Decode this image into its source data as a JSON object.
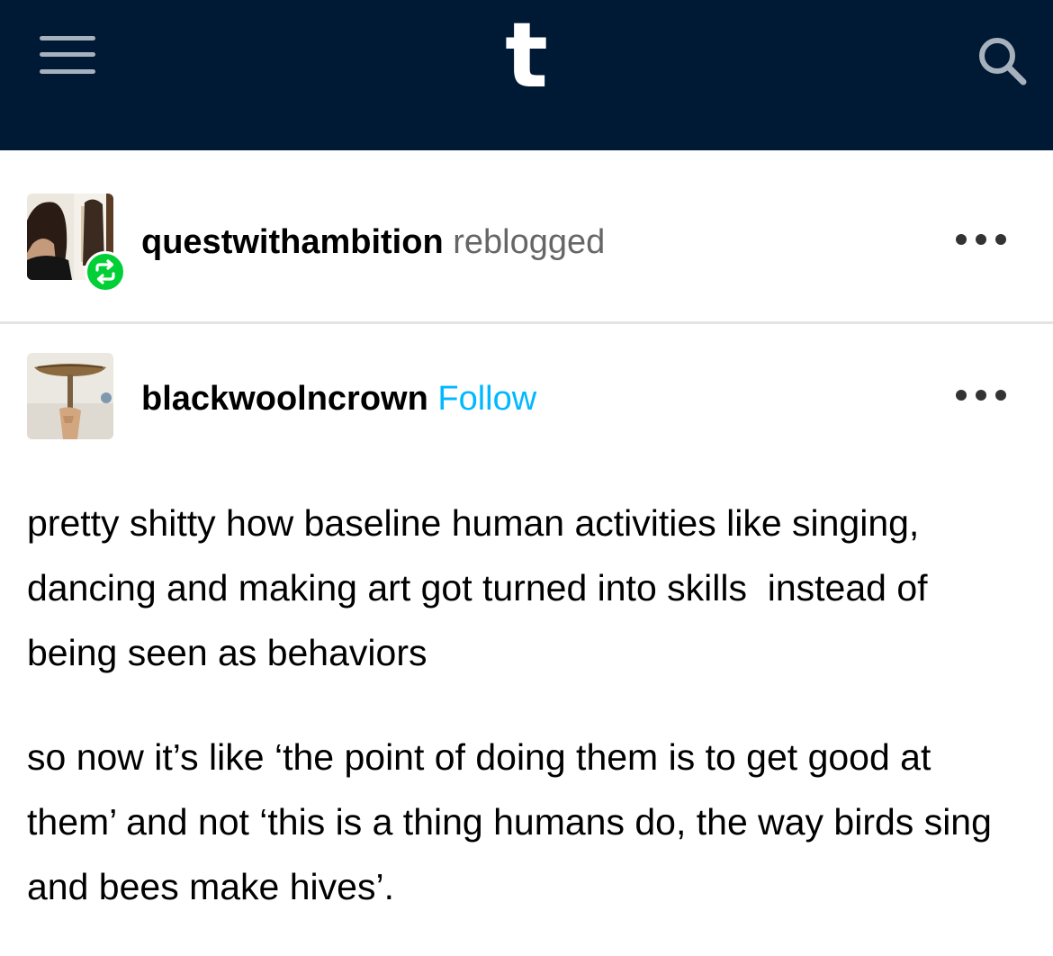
{
  "nav": {
    "logo": "t",
    "menu_icon": "hamburger-menu-icon",
    "search_icon": "search-icon",
    "background_color": "#001935"
  },
  "reblog": {
    "blogname": "questwithambition",
    "action": "reblogged",
    "badge_icon": "reblog-icon",
    "badge_color": "#00cf35",
    "more_icon": "more-options-icon"
  },
  "post": {
    "author": "blackwoolncrown",
    "follow_label": "Follow",
    "follow_color": "#00b8ff",
    "more_icon": "more-options-icon",
    "paragraphs": [
      "pretty shitty how baseline human activities like singing, dancing and making art got turned into skills  instead of being seen as behaviors",
      "so now it’s like ‘the point of doing them is to get good at them’ and not ‘this is a thing humans do, the way birds sing and bees make hives’."
    ]
  }
}
